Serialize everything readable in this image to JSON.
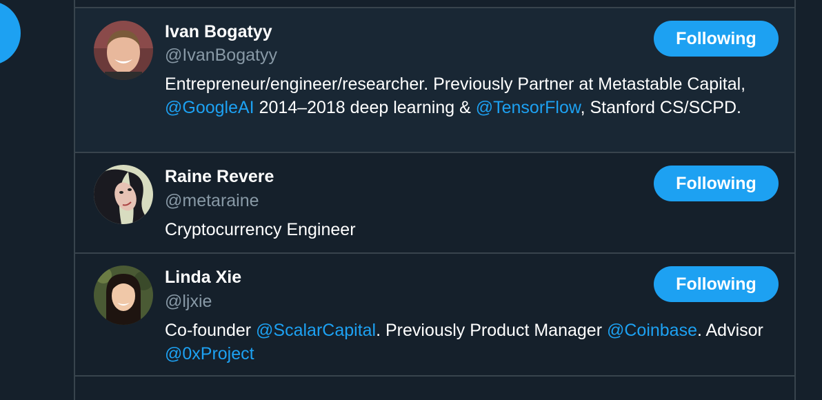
{
  "follow_list": [
    {
      "name": "Ivan Bogatyy",
      "handle": "@IvanBogatyy",
      "button": "Following",
      "bio": {
        "t1": "Entrepreneur/engineer/researcher. Previously Partner at Metastable Capital, ",
        "l1": "@GoogleAI",
        "t2": " 2014–2018 deep learning & ",
        "l2": "@TensorFlow",
        "t3": ", Stanford CS/SCPD."
      }
    },
    {
      "name": "Raine Revere",
      "handle": "@metaraine",
      "button": "Following",
      "bio": {
        "t1": "Cryptocurrency Engineer"
      }
    },
    {
      "name": "Linda Xie",
      "handle": "@ljxie",
      "button": "Following",
      "bio": {
        "t1": "Co-founder ",
        "l1": "@ScalarCapital",
        "t2": ". Previously Product Manager ",
        "l2": "@Coinbase",
        "t3": ". Advisor ",
        "l3": "@0xProject"
      }
    }
  ],
  "colors": {
    "background": "#15202b",
    "row_highlight": "#192734",
    "accent": "#1da1f2",
    "border": "#38444d",
    "secondary_text": "#8899a6"
  }
}
